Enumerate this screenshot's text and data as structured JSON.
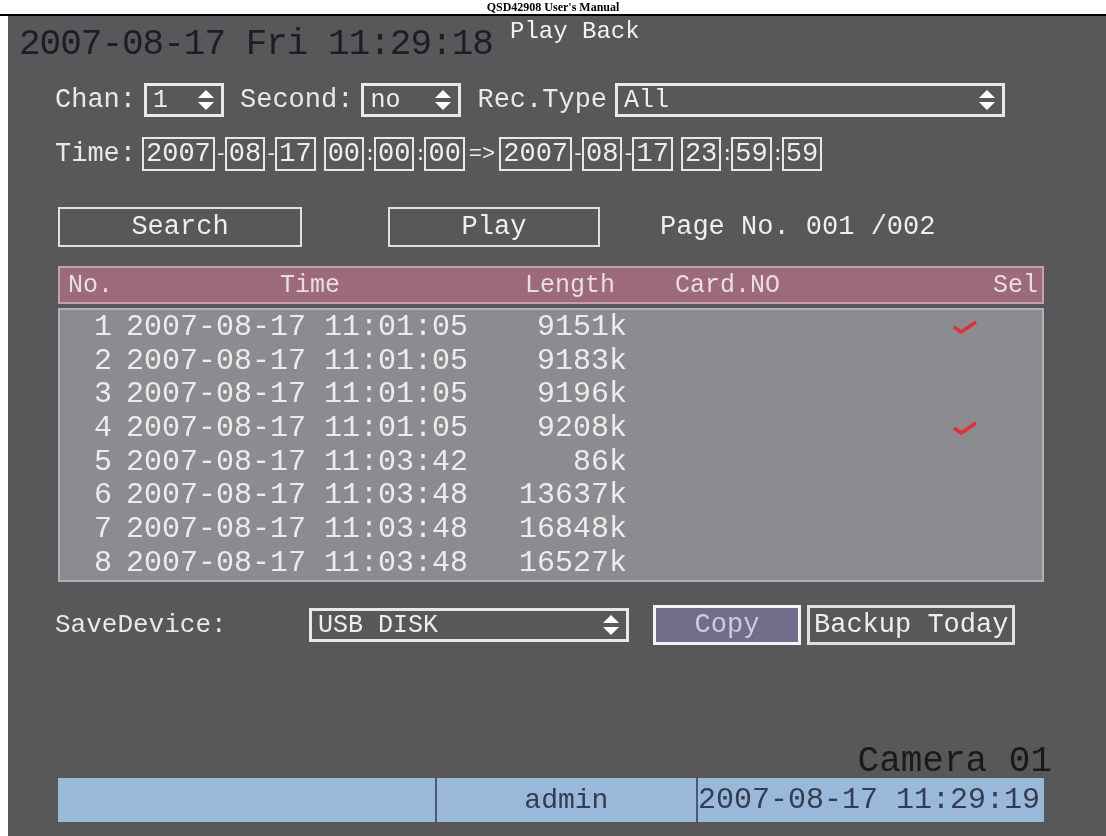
{
  "document_header": "QSD42908 User's Manual",
  "screen": {
    "clock": "2007-08-17 Fri 11:29:18",
    "title": "Play Back",
    "filters": [
      {
        "label": "Chan:",
        "value": "1",
        "kind": "short"
      },
      {
        "label": "Second:",
        "value": "no",
        "kind": "medium"
      },
      {
        "label": "Rec.Type",
        "value": "All",
        "kind": "long"
      }
    ],
    "time": {
      "label": "Time:",
      "date_sep": "-",
      "time_sep": ":",
      "arrow": "=>",
      "start": [
        "2007",
        "08",
        "17",
        "00",
        "00",
        "00"
      ],
      "end": [
        "2007",
        "08",
        "17",
        "23",
        "59",
        "59"
      ]
    },
    "actions": [
      {
        "label": "Search"
      },
      {
        "label": "Play"
      }
    ],
    "page_no": "Page No. 001 /002",
    "table": {
      "columns": [
        "No.",
        "Time",
        "Length",
        "Card.NO",
        "Sel"
      ],
      "rows": [
        {
          "no": "1",
          "time": "2007-08-17 11:01:05",
          "length": "9151k",
          "selected": true
        },
        {
          "no": "2",
          "time": "2007-08-17 11:01:05",
          "length": "9183k",
          "selected": false
        },
        {
          "no": "3",
          "time": "2007-08-17 11:01:05",
          "length": "9196k",
          "selected": false
        },
        {
          "no": "4",
          "time": "2007-08-17 11:01:05",
          "length": "9208k",
          "selected": true
        },
        {
          "no": "5",
          "time": "2007-08-17 11:03:42",
          "length": "86k",
          "selected": false
        },
        {
          "no": "6",
          "time": "2007-08-17 11:03:48",
          "length": "13637k",
          "selected": false
        },
        {
          "no": "7",
          "time": "2007-08-17 11:03:48",
          "length": "16848k",
          "selected": false
        },
        {
          "no": "8",
          "time": "2007-08-17 11:03:48",
          "length": "16527k",
          "selected": false
        }
      ]
    },
    "save_device": {
      "label": "SaveDevice:",
      "value": "USB DISK"
    },
    "buttons": [
      {
        "label": "Copy",
        "focused": true
      },
      {
        "label": "Backup Today",
        "focused": false
      }
    ],
    "camera_label": "Camera 01",
    "status_bar": {
      "user": "admin",
      "datetime": "2007-08-17 11:29:19"
    }
  }
}
